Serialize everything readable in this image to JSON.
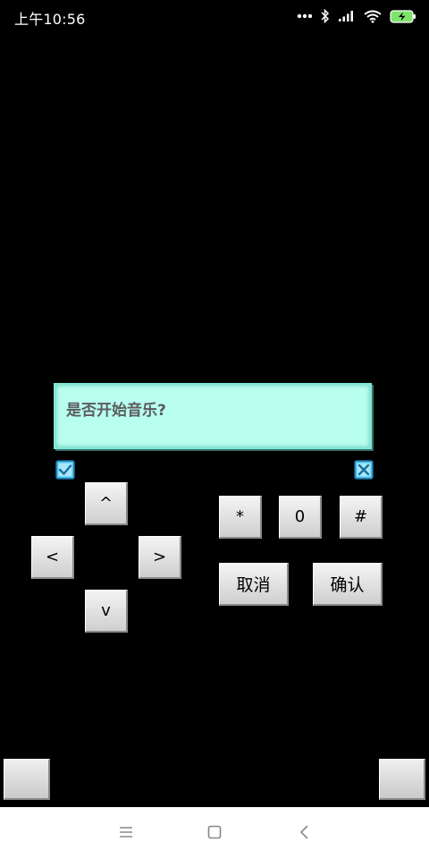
{
  "status_bar": {
    "time": "上午10:56",
    "icons": [
      "dots-icon",
      "bluetooth-icon",
      "signal-icon",
      "wifi-icon",
      "battery-charging-icon"
    ]
  },
  "dialog": {
    "message": "是否开始音乐?",
    "background_color": "#b8fff0"
  },
  "checkboxes": {
    "left": "checkmark-icon",
    "right": "cross-icon",
    "color": "#29a9e0"
  },
  "dpad": {
    "up": "^",
    "left": "<",
    "right": ">",
    "down": "v"
  },
  "keypad": {
    "star": "*",
    "zero": "0",
    "hash": "#",
    "cancel": "取消",
    "confirm": "确认"
  },
  "nav_bar": {
    "icons": [
      "menu-icon",
      "home-icon",
      "back-icon"
    ]
  }
}
